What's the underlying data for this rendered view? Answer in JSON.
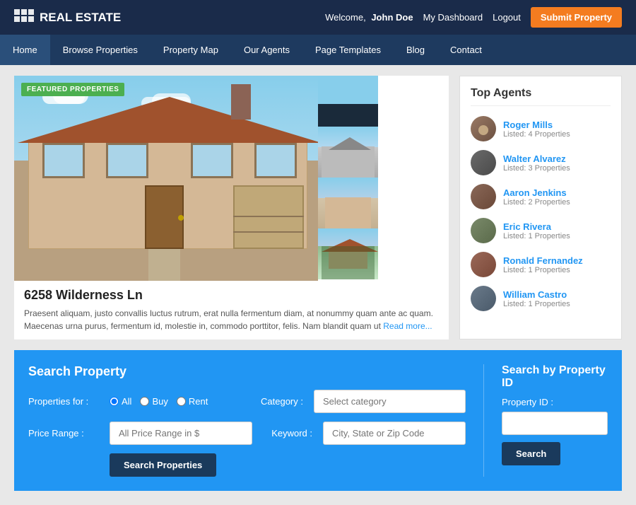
{
  "header": {
    "logo_text": "REAL ESTATE",
    "welcome_prefix": "Welcome,",
    "username": "John Doe",
    "dashboard_link": "My Dashboard",
    "logout_link": "Logout",
    "submit_btn": "Submit Property"
  },
  "nav": {
    "items": [
      {
        "label": "Home",
        "active": true
      },
      {
        "label": "Browse Properties",
        "active": false
      },
      {
        "label": "Property Map",
        "active": false
      },
      {
        "label": "Our Agents",
        "active": false
      },
      {
        "label": "Page Templates",
        "active": false
      },
      {
        "label": "Blog",
        "active": false
      },
      {
        "label": "Contact",
        "active": false
      }
    ]
  },
  "featured": {
    "badge": "FEATURED PROPERTIES",
    "property_title": "6258 Wilderness Ln",
    "property_desc": "Praesent aliquam, justo convallis luctus rutrum, erat nulla fermentum diam, at nonummy quam ante ac quam. Maecenas urna purus, fermentum id, molestie in, commodo porttitor, felis. Nam blandit quam ut",
    "read_more": "Read more..."
  },
  "agents": {
    "title": "Top Agents",
    "items": [
      {
        "name": "Roger Mills",
        "listed": "Listed: 4 Properties"
      },
      {
        "name": "Walter Alvarez",
        "listed": "Listed: 3 Properties"
      },
      {
        "name": "Aaron Jenkins",
        "listed": "Listed: 2 Properties"
      },
      {
        "name": "Eric Rivera",
        "listed": "Listed: 1 Properties"
      },
      {
        "name": "Ronald Fernandez",
        "listed": "Listed: 1 Properties"
      },
      {
        "name": "William Castro",
        "listed": "Listed: 1 Properties"
      }
    ]
  },
  "search": {
    "title": "Search Property",
    "properties_for_label": "Properties for :",
    "radio_options": [
      "All",
      "Buy",
      "Rent"
    ],
    "category_label": "Category :",
    "category_placeholder": "Select category",
    "price_label": "Price Range :",
    "price_placeholder": "All Price Range in $",
    "keyword_label": "Keyword :",
    "keyword_placeholder": "City, State or Zip Code",
    "search_btn": "Search Properties",
    "search_by_id_title": "Search by Property ID",
    "property_id_label": "Property ID :",
    "property_id_placeholder": "",
    "id_search_btn": "Search"
  }
}
